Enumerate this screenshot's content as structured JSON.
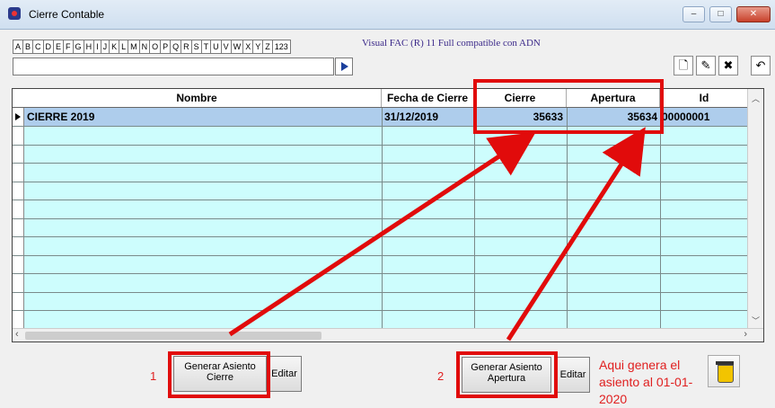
{
  "window": {
    "title": "Cierre Contable",
    "minimize": "–",
    "maximize": "□",
    "close": "✕"
  },
  "alphabet": [
    "A",
    "B",
    "C",
    "D",
    "E",
    "F",
    "G",
    "H",
    "I",
    "J",
    "K",
    "L",
    "M",
    "N",
    "O",
    "P",
    "Q",
    "R",
    "S",
    "T",
    "U",
    "V",
    "W",
    "X",
    "Y",
    "Z",
    "123"
  ],
  "tagline": "Visual FAC (R) 11 Full compatible con ADN",
  "toolbar": [
    {
      "name": "new-document-icon",
      "glyph": "🗋"
    },
    {
      "name": "edit-record-icon",
      "glyph": "✎"
    },
    {
      "name": "delete-record-icon",
      "glyph": "✖"
    },
    {
      "name": "undo-icon",
      "glyph": "↶"
    }
  ],
  "grid": {
    "columns": [
      "Nombre",
      "Fecha de Cierre",
      "Cierre",
      "Apertura",
      "Id"
    ],
    "rows": [
      {
        "nombre": "CIERRE 2019",
        "fecha": "31/12/2019",
        "cierre": "35633",
        "apertura": "35634",
        "id": "00000001"
      }
    ]
  },
  "buttons": {
    "generar_cierre": "Generar Asiento Cierre",
    "editar1": "Editar",
    "generar_apertura": "Generar Asiento Apertura",
    "editar2": "Editar"
  },
  "annotations": {
    "step1": "1",
    "step2": "2",
    "note": "Aqui genera el asiento al 01-01-2020",
    "accent_color": "#e10b0b"
  }
}
